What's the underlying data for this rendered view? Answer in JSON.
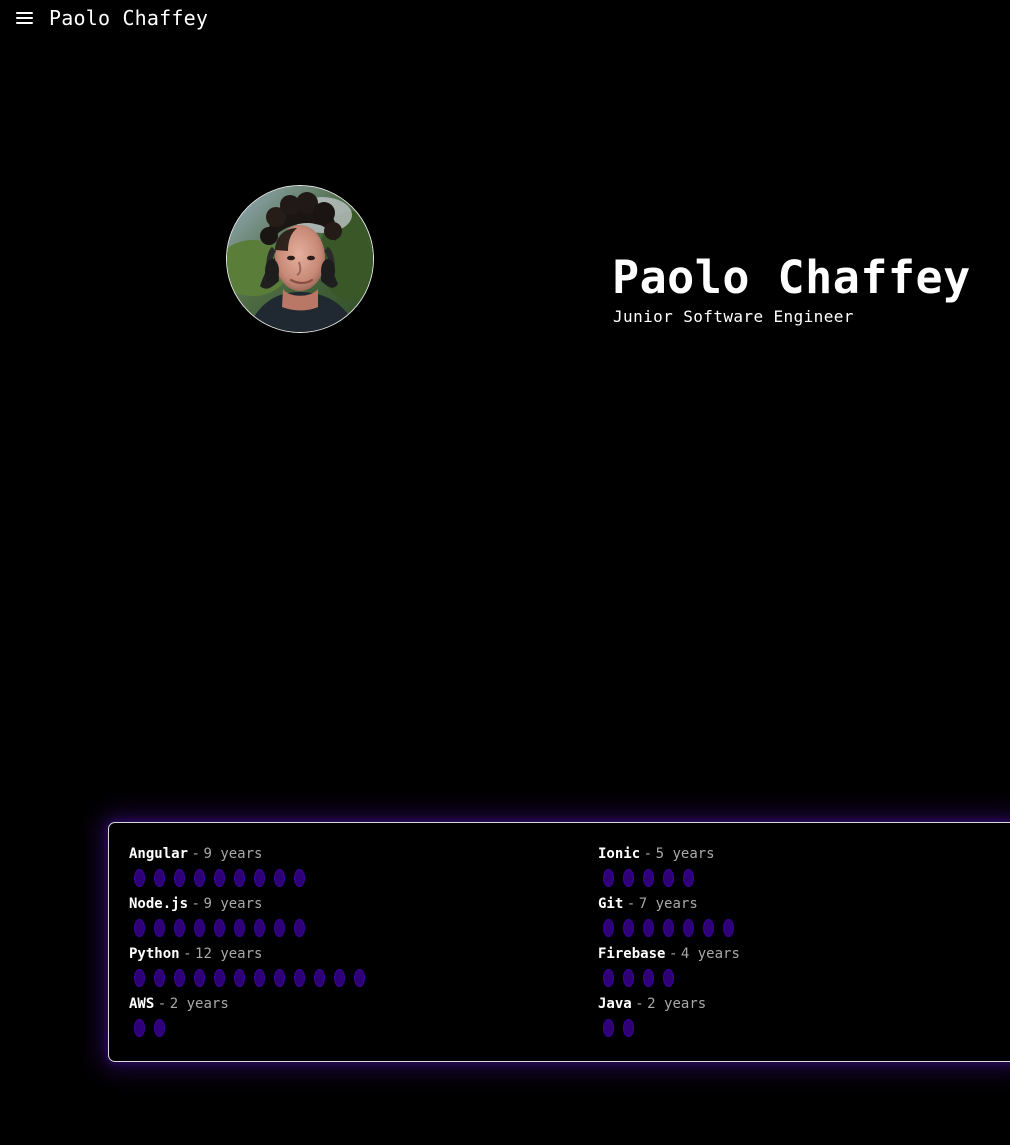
{
  "header": {
    "title": "Paolo Chaffey",
    "menu_icon": "hamburger-menu-icon"
  },
  "profile": {
    "avatar_icon": "profile-photo",
    "name": "Paolo Chaffey",
    "subtitle": "Junior Software Engineer"
  },
  "colors": {
    "background": "#000000",
    "text": "#ffffff",
    "muted_text": "#a8a8a8",
    "card_border": "#d8d8d8",
    "card_glow": "#761dff",
    "skill_dot": "#2e0078"
  },
  "skills": {
    "separator": "-",
    "unit": "years",
    "items": [
      {
        "name": "Angular",
        "years": 9
      },
      {
        "name": "Ionic",
        "years": 5
      },
      {
        "name": "Node.js",
        "years": 9
      },
      {
        "name": "Git",
        "years": 7
      },
      {
        "name": "Python",
        "years": 12
      },
      {
        "name": "Firebase",
        "years": 4
      },
      {
        "name": "AWS",
        "years": 2
      },
      {
        "name": "Java",
        "years": 2
      }
    ]
  }
}
